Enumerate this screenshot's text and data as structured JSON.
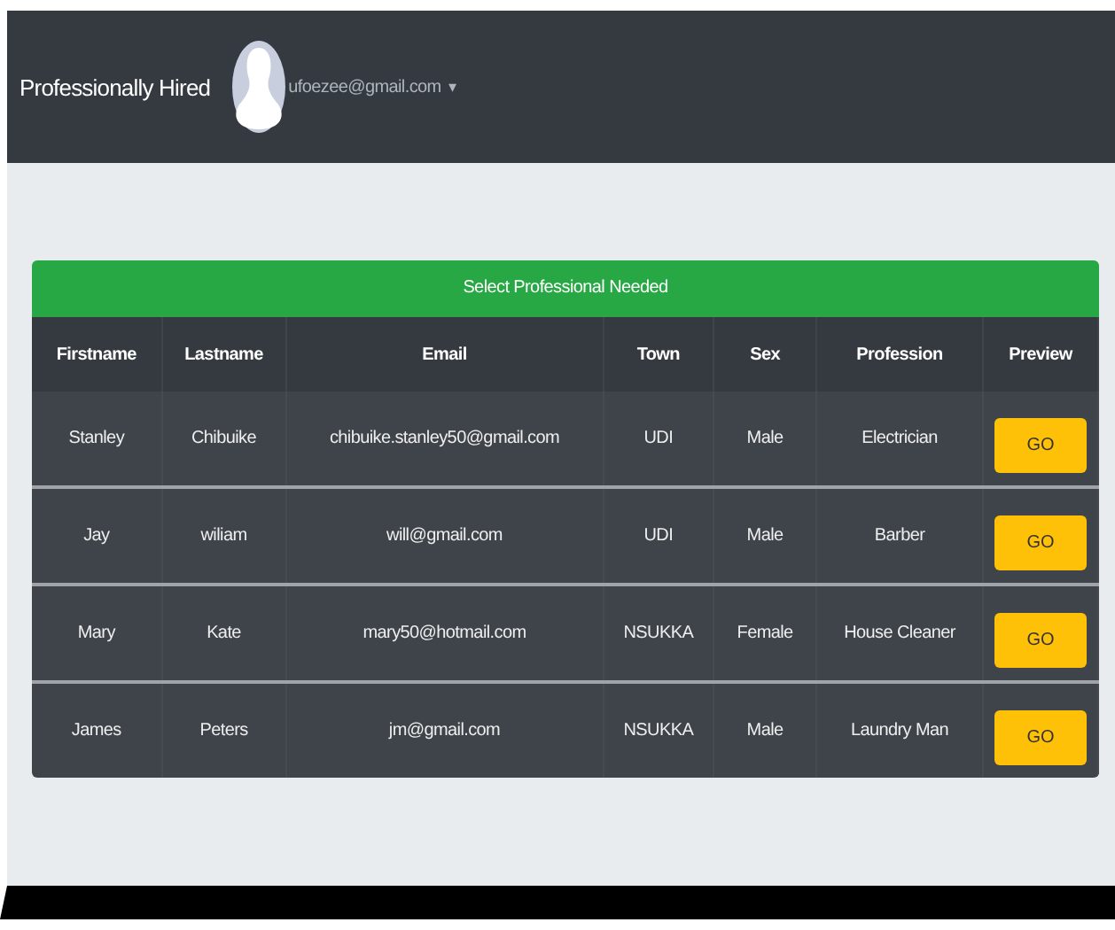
{
  "navbar": {
    "brand": "Professionally Hired",
    "user_email": "ufoezee@gmail.com",
    "dropdown_caret": "▾"
  },
  "table": {
    "title": "Select Professional Needed",
    "columns": [
      "Firstname",
      "Lastname",
      "Email",
      "Town",
      "Sex",
      "Profession",
      "Preview"
    ],
    "rows": [
      {
        "firstname": "Stanley",
        "lastname": "Chibuike",
        "email": "chibuike.stanley50@gmail.com",
        "town": "UDI",
        "sex": "Male",
        "profession": "Electrician",
        "action": "GO"
      },
      {
        "firstname": "Jay",
        "lastname": "wiliam",
        "email": "will@gmail.com",
        "town": "UDI",
        "sex": "Male",
        "profession": "Barber",
        "action": "GO"
      },
      {
        "firstname": "Mary",
        "lastname": "Kate",
        "email": "mary50@hotmail.com",
        "town": "NSUKKA",
        "sex": "Female",
        "profession": "House Cleaner",
        "action": "GO"
      },
      {
        "firstname": "James",
        "lastname": "Peters",
        "email": "jm@gmail.com",
        "town": "NSUKKA",
        "sex": "Male",
        "profession": "Laundry Man",
        "action": "GO"
      }
    ]
  }
}
